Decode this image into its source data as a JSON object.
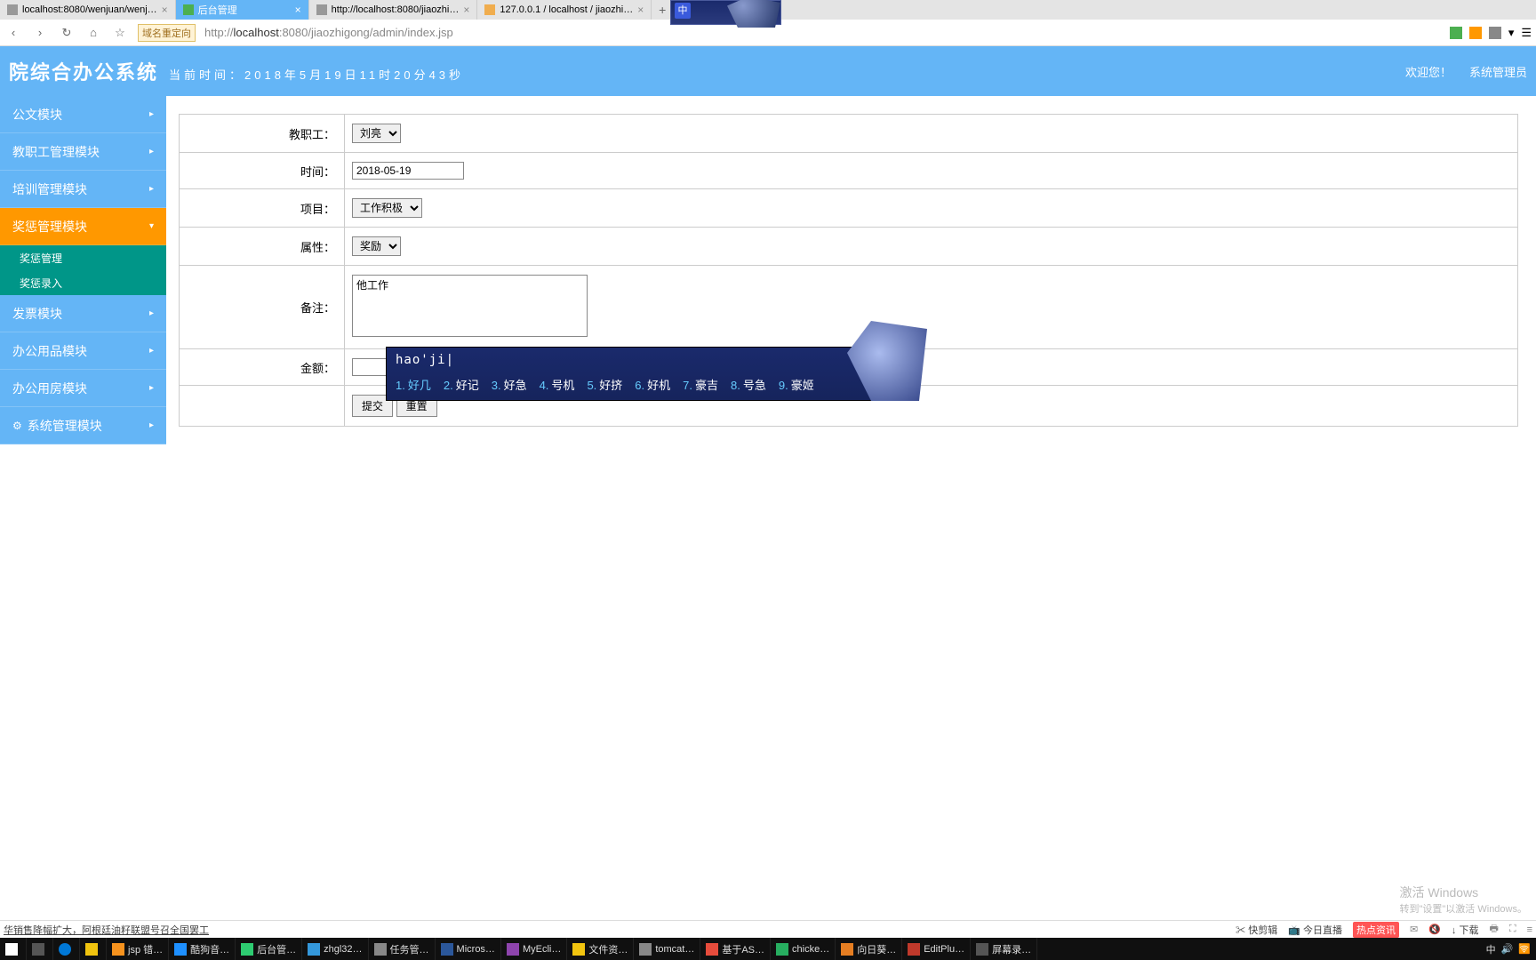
{
  "browser": {
    "tabs": [
      {
        "title": "localhost:8080/wenjuan/wenj…"
      },
      {
        "title": "后台管理",
        "active": true
      },
      {
        "title": "http://localhost:8080/jiaozhi…"
      },
      {
        "title": "127.0.0.1 / localhost / jiaozhi…"
      }
    ],
    "badge": "域名重定向",
    "url_prefix": "http://",
    "url_host": "localhost",
    "url_rest": ":8080/jiaozhigong/admin/index.jsp"
  },
  "header": {
    "title": "院综合办公系统",
    "time_label": "当前时间：2018年5月19日11时20分43秒",
    "welcome": "欢迎您！",
    "role": "系统管理员"
  },
  "sidebar": {
    "items": [
      {
        "label": "公文模块"
      },
      {
        "label": "教职工管理模块"
      },
      {
        "label": "培训管理模块"
      },
      {
        "label": "奖惩管理模块",
        "active": true,
        "subs": [
          {
            "label": "奖惩管理"
          },
          {
            "label": "奖惩录入"
          }
        ]
      },
      {
        "label": "发票模块"
      },
      {
        "label": "办公用品模块"
      },
      {
        "label": "办公用房模块"
      },
      {
        "label": "系统管理模块",
        "gear": true
      }
    ]
  },
  "form": {
    "labels": {
      "teacher": "教职工：",
      "time": "时间：",
      "project": "项目：",
      "attribute": "属性：",
      "remark": "备注：",
      "amount": "金额："
    },
    "teacher_value": "刘亮",
    "time_value": "2018-05-19",
    "project_value": "工作积极",
    "attribute_value": "奖励",
    "remark_value": "他工作",
    "amount_value": "",
    "submit": "提交",
    "reset": "重置"
  },
  "ime": {
    "indicator": "中",
    "input": "hao'ji",
    "candidates": [
      {
        "n": "1.",
        "w": "好几"
      },
      {
        "n": "2.",
        "w": "好记"
      },
      {
        "n": "3.",
        "w": "好急"
      },
      {
        "n": "4.",
        "w": "号机"
      },
      {
        "n": "5.",
        "w": "好挤"
      },
      {
        "n": "6.",
        "w": "好机"
      },
      {
        "n": "7.",
        "w": "豪吉"
      },
      {
        "n": "8.",
        "w": "号急"
      },
      {
        "n": "9.",
        "w": "豪姬"
      }
    ]
  },
  "ticker": {
    "news": "华销售降幅扩大，阿根廷油籽联盟号召全国罢工",
    "items": [
      "快剪辑",
      "今日直播",
      "热点资讯",
      "下载"
    ]
  },
  "watermark": {
    "line1": "激活 Windows",
    "line2": "转到\"设置\"以激活 Windows。"
  },
  "taskbar": {
    "items": [
      {
        "label": "jsp 错…",
        "color": "#f7931e"
      },
      {
        "label": "酷狗音…",
        "color": "#1e90ff"
      },
      {
        "label": "后台管…",
        "color": "#2ecc71"
      },
      {
        "label": "zhgl32…",
        "color": "#3498db"
      },
      {
        "label": "任务管…",
        "color": "#888"
      },
      {
        "label": "Micros…",
        "color": "#2b579a"
      },
      {
        "label": "MyEcli…",
        "color": "#8e44ad"
      },
      {
        "label": "文件资…",
        "color": "#f1c40f"
      },
      {
        "label": "tomcat…",
        "color": "#888"
      },
      {
        "label": "基于AS…",
        "color": "#e74c3c"
      },
      {
        "label": "chicke…",
        "color": "#27ae60"
      },
      {
        "label": "向日葵…",
        "color": "#e67e22"
      },
      {
        "label": "EditPlu…",
        "color": "#c0392b"
      },
      {
        "label": "屏幕录…",
        "color": "#555"
      }
    ],
    "tray": "中"
  }
}
